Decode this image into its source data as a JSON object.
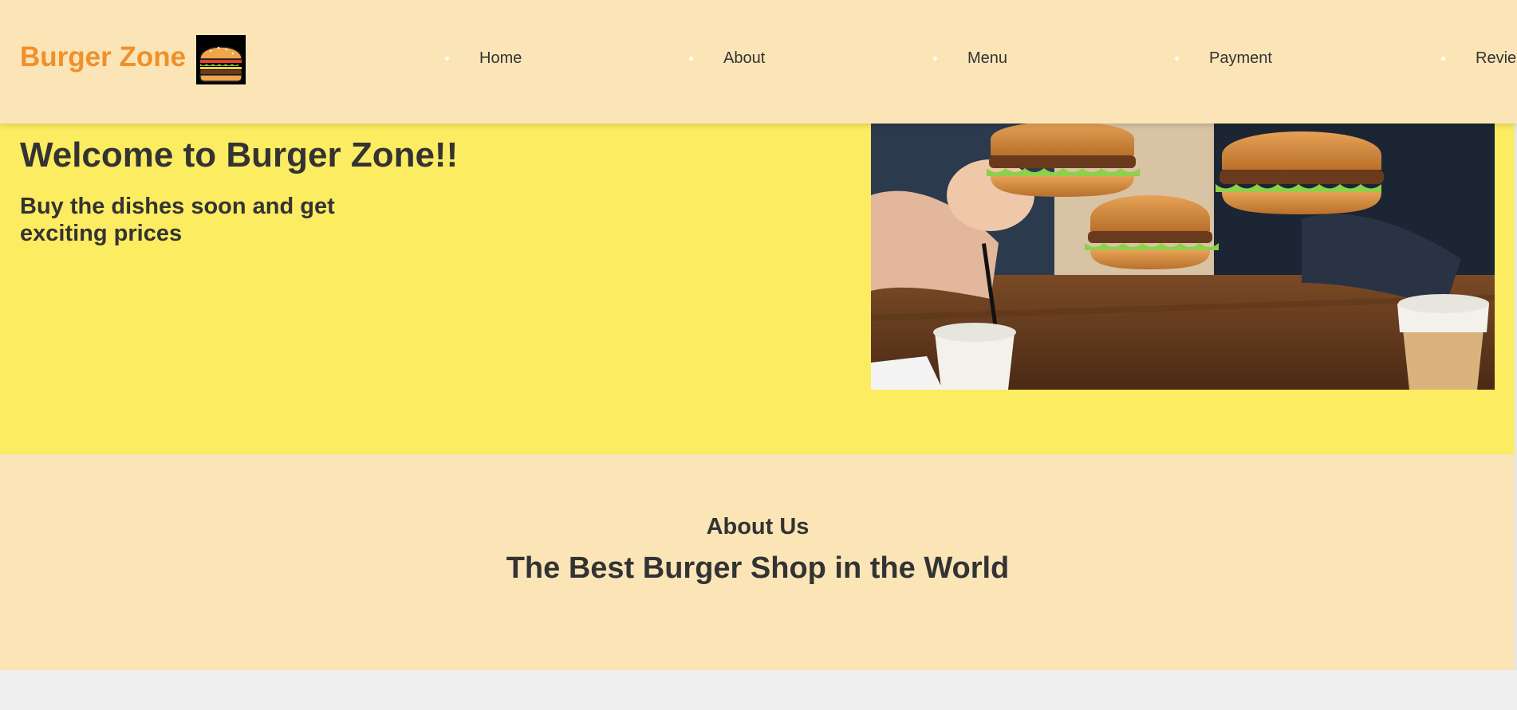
{
  "header": {
    "brand": "Burger Zone",
    "logo_icon": "burger-icon",
    "nav": [
      {
        "label": "Home"
      },
      {
        "label": "About"
      },
      {
        "label": "Menu"
      },
      {
        "label": "Payment"
      },
      {
        "label": "Revie"
      }
    ]
  },
  "hero": {
    "title": "Welcome to Burger Zone!!",
    "subtitle": "Buy the dishes soon and get exciting prices",
    "photo_icon": "burgers-photo"
  },
  "about": {
    "label": "About Us",
    "title": "The Best Burger Shop in the World"
  },
  "colors": {
    "header_bg": "#fbe5b7",
    "hero_bg": "#fcec61",
    "brand": "#f0902b",
    "text": "#333333",
    "page_bg": "#efefef"
  }
}
